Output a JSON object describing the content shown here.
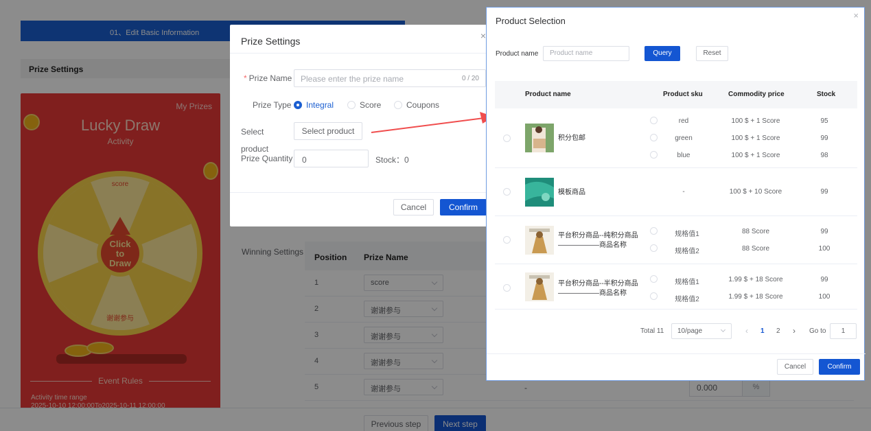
{
  "steps": {
    "step1": "01、Edit Basic Information"
  },
  "section": {
    "title": "Prize Settings"
  },
  "preview": {
    "my_prizes": "My Prizes",
    "title": "Lucky Draw",
    "subtitle": "Activity",
    "wheel_center": [
      "Click",
      "to",
      "Draw"
    ],
    "wheel_top_label": "score",
    "wheel_slice_label": "谢谢参与",
    "event_rules": "Event Rules",
    "time_label": "Activity time range",
    "time_value": "2025-10-10 12:00:00To2025-10-11 12:00:00",
    "colors": {
      "bg": "#ea3a37",
      "wheel_yellow": "#f7d14a",
      "wheel_light": "#fde79a",
      "center": "#e64a2e"
    }
  },
  "winning": {
    "label": "Winning Settings",
    "columns": {
      "position": "Position",
      "prize_name": "Prize Name"
    },
    "rows": [
      {
        "position": "1",
        "prize": "score"
      },
      {
        "position": "2",
        "prize": "谢谢参与"
      },
      {
        "position": "3",
        "prize": "谢谢参与"
      },
      {
        "position": "4",
        "prize": "谢谢参与"
      },
      {
        "position": "5",
        "prize": "谢谢参与",
        "dash": "-",
        "pct_value": "0.000",
        "pct_unit": "%"
      }
    ]
  },
  "footer": {
    "prev": "Previous step",
    "next": "Next step"
  },
  "prize_dialog": {
    "title": "Prize Settings",
    "close": "×",
    "prize_name_label": "Prize Name",
    "prize_name_placeholder": "Please enter the prize name",
    "prize_name_count": "0 / 20",
    "prize_type_label": "Prize Type",
    "types": [
      "Integral",
      "Score",
      "Coupons"
    ],
    "selected_type": "Integral",
    "select_label": "Select",
    "select_label2": "product",
    "select_button": "Select product",
    "quantity_label": "Prize Quantity",
    "quantity_value": "0",
    "stock_label": "Stock：0",
    "cancel": "Cancel",
    "confirm": "Confirm"
  },
  "product_dialog": {
    "title": "Product Selection",
    "close": "×",
    "search_label": "Product name",
    "search_placeholder": "Product name",
    "query": "Query",
    "reset": "Reset",
    "columns": {
      "name": "Product name",
      "sku": "Product sku",
      "price": "Commodity price",
      "stock": "Stock"
    },
    "products": [
      {
        "name": "积分包邮",
        "image": "dress-photo",
        "skus": [
          {
            "sku": "red",
            "price": "100 $ + 1 Score",
            "stock": "95"
          },
          {
            "sku": "green",
            "price": "100 $ + 1 Score",
            "stock": "99"
          },
          {
            "sku": "blue",
            "price": "100 $ + 1 Score",
            "stock": "98"
          }
        ]
      },
      {
        "name": "模板商品",
        "image": "aerial-photo",
        "skus": [
          {
            "sku": "-",
            "price": "100 $ + 10 Score",
            "stock": "99"
          }
        ]
      },
      {
        "name_line1": "平台积分商品--纯积分商品",
        "name_line2": "——————商品名称",
        "image": "poster-photo",
        "skus": [
          {
            "sku": "规格值1",
            "price": "88 Score",
            "stock": "99"
          },
          {
            "sku": "规格值2",
            "price": "88 Score",
            "stock": "100"
          }
        ]
      },
      {
        "name_line1": "平台积分商品--半积分商品",
        "name_line2": "——————商品名称",
        "image": "poster-photo",
        "skus": [
          {
            "sku": "规格值1",
            "price": "1.99 $ + 18 Score",
            "stock": "99"
          },
          {
            "sku": "规格值2",
            "price": "1.99 $ + 18 Score",
            "stock": "100"
          }
        ]
      }
    ],
    "pager": {
      "total": "Total 11",
      "page_size": "10/page",
      "prev": "‹",
      "page1": "1",
      "page2": "2",
      "next": "›",
      "goto_label": "Go to",
      "goto_value": "1"
    },
    "cancel": "Cancel",
    "confirm": "Confirm",
    "accent": "#1456d2"
  },
  "annotation": {
    "arrow_color": "#f04d4d"
  }
}
